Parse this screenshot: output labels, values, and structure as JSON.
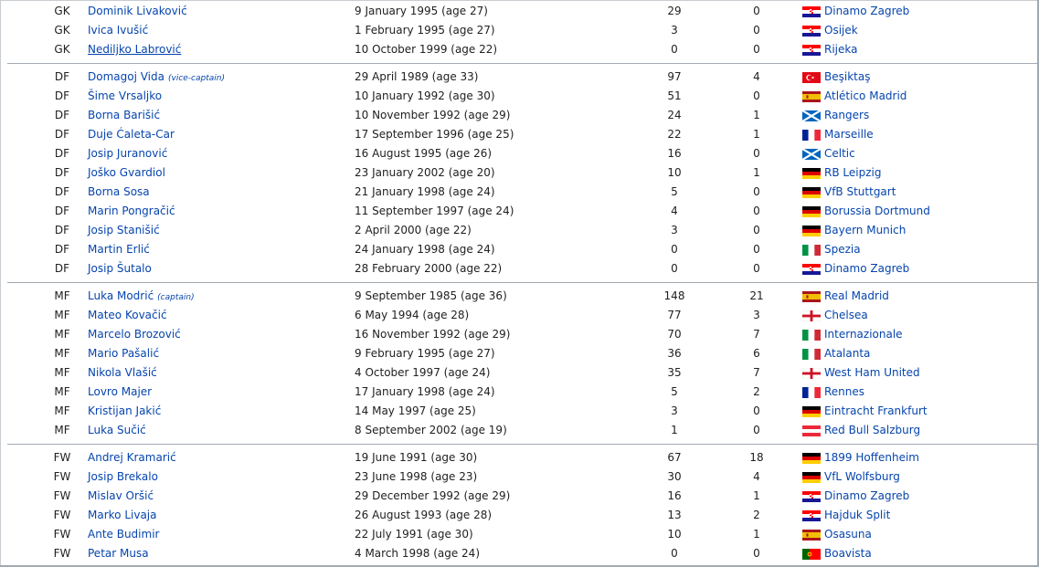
{
  "groups": [
    {
      "players": [
        {
          "pos": "GK",
          "name": "Dominik Livaković",
          "dob": "9 January 1995 (age 27)",
          "caps": "29",
          "goals": "0",
          "flag": "croatia-flag",
          "club": "Dinamo Zagreb"
        },
        {
          "pos": "GK",
          "name": "Ivica Ivušić",
          "dob": "1 February 1995 (age 27)",
          "caps": "3",
          "goals": "0",
          "flag": "croatia-flag",
          "club": "Osijek"
        },
        {
          "pos": "GK",
          "name": "Nediljko Labrović",
          "dob": "10 October 1999 (age 22)",
          "caps": "0",
          "goals": "0",
          "flag": "croatia-flag",
          "club": "Rijeka",
          "underline": true
        }
      ]
    },
    {
      "players": [
        {
          "pos": "DF",
          "name": "Domagoj Vida",
          "role": "(vice-captain)",
          "dob": "29 April 1989 (age 33)",
          "caps": "97",
          "goals": "4",
          "flag": "turkey-flag",
          "club": "Beşiktaş"
        },
        {
          "pos": "DF",
          "name": "Šime Vrsaljko",
          "dob": "10 January 1992 (age 30)",
          "caps": "51",
          "goals": "0",
          "flag": "spain-flag",
          "club": "Atlético Madrid"
        },
        {
          "pos": "DF",
          "name": "Borna Barišić",
          "dob": "10 November 1992 (age 29)",
          "caps": "24",
          "goals": "1",
          "flag": "scotland-flag",
          "club": "Rangers"
        },
        {
          "pos": "DF",
          "name": "Duje Ćaleta-Car",
          "dob": "17 September 1996 (age 25)",
          "caps": "22",
          "goals": "1",
          "flag": "france-flag",
          "club": "Marseille"
        },
        {
          "pos": "DF",
          "name": "Josip Juranović",
          "dob": "16 August 1995 (age 26)",
          "caps": "16",
          "goals": "0",
          "flag": "scotland-flag",
          "club": "Celtic"
        },
        {
          "pos": "DF",
          "name": "Joško Gvardiol",
          "dob": "23 January 2002 (age 20)",
          "caps": "10",
          "goals": "1",
          "flag": "germany-flag",
          "club": "RB Leipzig"
        },
        {
          "pos": "DF",
          "name": "Borna Sosa",
          "dob": "21 January 1998 (age 24)",
          "caps": "5",
          "goals": "0",
          "flag": "germany-flag",
          "club": "VfB Stuttgart"
        },
        {
          "pos": "DF",
          "name": "Marin Pongračić",
          "dob": "11 September 1997 (age 24)",
          "caps": "4",
          "goals": "0",
          "flag": "germany-flag",
          "club": "Borussia Dortmund"
        },
        {
          "pos": "DF",
          "name": "Josip Stanišić",
          "dob": "2 April 2000 (age 22)",
          "caps": "3",
          "goals": "0",
          "flag": "germany-flag",
          "club": "Bayern Munich"
        },
        {
          "pos": "DF",
          "name": "Martin Erlić",
          "dob": "24 January 1998 (age 24)",
          "caps": "0",
          "goals": "0",
          "flag": "italy-flag",
          "club": "Spezia"
        },
        {
          "pos": "DF",
          "name": "Josip Šutalo",
          "dob": "28 February 2000 (age 22)",
          "caps": "0",
          "goals": "0",
          "flag": "croatia-flag",
          "club": "Dinamo Zagreb"
        }
      ]
    },
    {
      "players": [
        {
          "pos": "MF",
          "name": "Luka Modrić",
          "role": "(captain)",
          "dob": "9 September 1985 (age 36)",
          "caps": "148",
          "goals": "21",
          "flag": "spain-flag",
          "club": "Real Madrid"
        },
        {
          "pos": "MF",
          "name": "Mateo Kovačić",
          "dob": "6 May 1994 (age 28)",
          "caps": "77",
          "goals": "3",
          "flag": "england-flag",
          "club": "Chelsea"
        },
        {
          "pos": "MF",
          "name": "Marcelo Brozović",
          "dob": "16 November 1992 (age 29)",
          "caps": "70",
          "goals": "7",
          "flag": "italy-flag",
          "club": "Internazionale"
        },
        {
          "pos": "MF",
          "name": "Mario Pašalić",
          "dob": "9 February 1995 (age 27)",
          "caps": "36",
          "goals": "6",
          "flag": "italy-flag",
          "club": "Atalanta"
        },
        {
          "pos": "MF",
          "name": "Nikola Vlašić",
          "dob": "4 October 1997 (age 24)",
          "caps": "35",
          "goals": "7",
          "flag": "england-flag",
          "club": "West Ham United"
        },
        {
          "pos": "MF",
          "name": "Lovro Majer",
          "dob": "17 January 1998 (age 24)",
          "caps": "5",
          "goals": "2",
          "flag": "france-flag",
          "club": "Rennes"
        },
        {
          "pos": "MF",
          "name": "Kristijan Jakić",
          "dob": "14 May 1997 (age 25)",
          "caps": "3",
          "goals": "0",
          "flag": "germany-flag",
          "club": "Eintracht Frankfurt"
        },
        {
          "pos": "MF",
          "name": "Luka Sučić",
          "dob": "8 September 2002 (age 19)",
          "caps": "1",
          "goals": "0",
          "flag": "austria-flag",
          "club": "Red Bull Salzburg"
        }
      ]
    },
    {
      "players": [
        {
          "pos": "FW",
          "name": "Andrej Kramarić",
          "dob": "19 June 1991 (age 30)",
          "caps": "67",
          "goals": "18",
          "flag": "germany-flag",
          "club": "1899 Hoffenheim"
        },
        {
          "pos": "FW",
          "name": "Josip Brekalo",
          "dob": "23 June 1998 (age 23)",
          "caps": "30",
          "goals": "4",
          "flag": "germany-flag",
          "club": "VfL Wolfsburg"
        },
        {
          "pos": "FW",
          "name": "Mislav Oršić",
          "dob": "29 December 1992 (age 29)",
          "caps": "16",
          "goals": "1",
          "flag": "croatia-flag",
          "club": "Dinamo Zagreb"
        },
        {
          "pos": "FW",
          "name": "Marko Livaja",
          "dob": "26 August 1993 (age 28)",
          "caps": "13",
          "goals": "2",
          "flag": "croatia-flag",
          "club": "Hajduk Split"
        },
        {
          "pos": "FW",
          "name": "Ante Budimir",
          "dob": "22 July 1991 (age 30)",
          "caps": "10",
          "goals": "1",
          "flag": "spain-flag",
          "club": "Osasuna"
        },
        {
          "pos": "FW",
          "name": "Petar Musa",
          "dob": "4 March 1998 (age 24)",
          "caps": "0",
          "goals": "0",
          "flag": "portugal-flag",
          "club": "Boavista"
        }
      ]
    }
  ]
}
